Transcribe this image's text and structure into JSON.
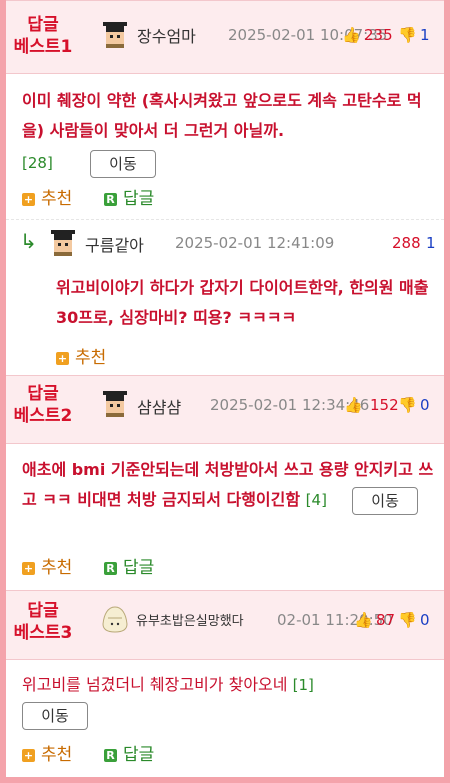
{
  "best_label": "답글\n베스트",
  "posts": [
    {
      "rank_line1": "답글",
      "rank_line2": "베스트1",
      "nickname": "장수엄마",
      "date": "2025-02-01 10:07:35",
      "likes": "235",
      "dislikes": "1",
      "content": "이미 췌장이 약한 (혹사시켜왔고 앞으로도 계속 고탄수로 먹을) 사람들이 맞아서 더 그런거 아닐까.",
      "reply_count": "[28]",
      "move_label": "이동",
      "recommend_label": "추천",
      "reply_label": "답글"
    },
    {
      "reply_marker": "↳",
      "nickname": "구름같아",
      "date": "2025-02-01 12:41:09",
      "likes": "288",
      "dislikes": "1",
      "content": "위고비이야기 하다가 갑자기 다이어트한약, 한의원 매출 30프로, 심장마비? 띠용? ㅋㅋㅋㅋ",
      "recommend_label": "추천"
    },
    {
      "rank_line1": "답글",
      "rank_line2": "베스트2",
      "nickname": "샴샴샴",
      "date": "2025-02-01 12:34:46",
      "likes": "152",
      "dislikes": "0",
      "content": "애초에 bmi 기준안되는데 처방받아서 쓰고 용량 안지키고 쓰고 ㅋㅋ 비대면 처방 금지되서 다행이긴함",
      "reply_count": "[4]",
      "move_label": "이동",
      "recommend_label": "추천",
      "reply_label": "답글"
    },
    {
      "rank_line1": "답글",
      "rank_line2": "베스트3",
      "nickname": "유부초밥은실망했다",
      "date": "02-01 11:20:50",
      "likes": "87",
      "dislikes": "0",
      "content": "위고비를 넘겼더니 췌장고비가 찾아오네",
      "reply_count": "[1]",
      "move_label": "이동",
      "recommend_label": "추천",
      "reply_label": "답글"
    }
  ],
  "colors": {
    "accent": "#d6102a",
    "border": "#f4a3ab",
    "header_bg": "#fdecee",
    "dislike": "#1a3fc4",
    "count": "#2b8a2b"
  }
}
